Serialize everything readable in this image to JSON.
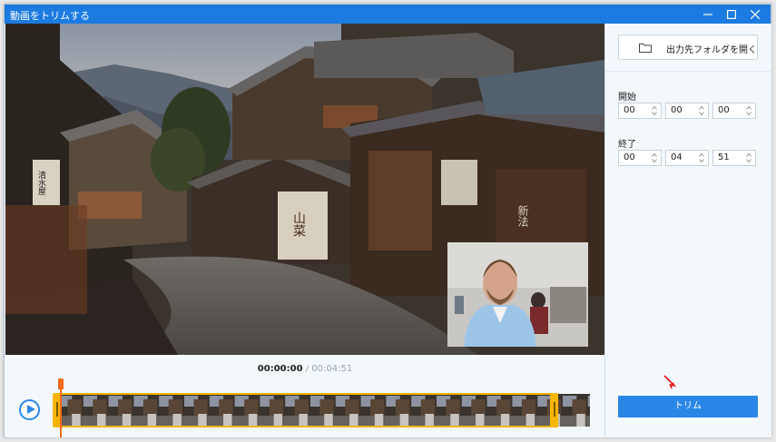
{
  "window": {
    "title": "動画をトリムする"
  },
  "player": {
    "current_time": "00:00:00",
    "separator": "/",
    "total_time": "00:04:51"
  },
  "panel": {
    "output_folder_label": "出力先フォルダを開く",
    "start": {
      "label": "開始",
      "hours": "00",
      "minutes": "00",
      "seconds": "00"
    },
    "end": {
      "label": "終了",
      "hours": "00",
      "minutes": "04",
      "seconds": "51"
    },
    "trim_label": "トリム"
  },
  "scene_signs": {
    "sign_left": "清水屋",
    "sign_shop": "山菜",
    "sign_right": "新法"
  },
  "colors": {
    "title_bar": "#1c7be0",
    "accent": "#2a87e8",
    "trim_handle": "#f7b500",
    "playhead": "#f06a1a"
  },
  "icons": {
    "play": "play-icon",
    "folder": "folder-icon",
    "minimize": "minimize-icon",
    "maximize": "maximize-icon",
    "close": "close-icon"
  }
}
